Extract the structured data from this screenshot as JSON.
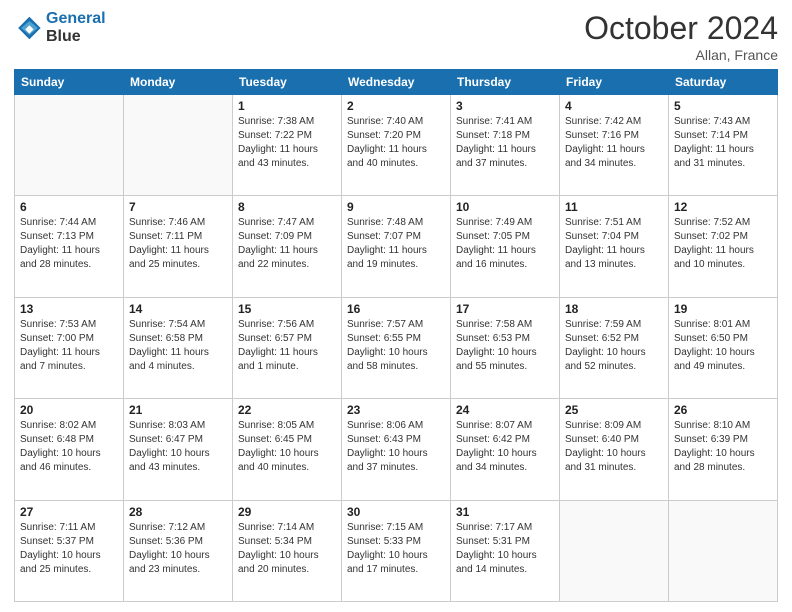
{
  "header": {
    "logo_line1": "General",
    "logo_line2": "Blue",
    "month_title": "October 2024",
    "location": "Allan, France"
  },
  "days_of_week": [
    "Sunday",
    "Monday",
    "Tuesday",
    "Wednesday",
    "Thursday",
    "Friday",
    "Saturday"
  ],
  "weeks": [
    [
      {
        "day": "",
        "info": ""
      },
      {
        "day": "",
        "info": ""
      },
      {
        "day": "1",
        "info": "Sunrise: 7:38 AM\nSunset: 7:22 PM\nDaylight: 11 hours and 43 minutes."
      },
      {
        "day": "2",
        "info": "Sunrise: 7:40 AM\nSunset: 7:20 PM\nDaylight: 11 hours and 40 minutes."
      },
      {
        "day": "3",
        "info": "Sunrise: 7:41 AM\nSunset: 7:18 PM\nDaylight: 11 hours and 37 minutes."
      },
      {
        "day": "4",
        "info": "Sunrise: 7:42 AM\nSunset: 7:16 PM\nDaylight: 11 hours and 34 minutes."
      },
      {
        "day": "5",
        "info": "Sunrise: 7:43 AM\nSunset: 7:14 PM\nDaylight: 11 hours and 31 minutes."
      }
    ],
    [
      {
        "day": "6",
        "info": "Sunrise: 7:44 AM\nSunset: 7:13 PM\nDaylight: 11 hours and 28 minutes."
      },
      {
        "day": "7",
        "info": "Sunrise: 7:46 AM\nSunset: 7:11 PM\nDaylight: 11 hours and 25 minutes."
      },
      {
        "day": "8",
        "info": "Sunrise: 7:47 AM\nSunset: 7:09 PM\nDaylight: 11 hours and 22 minutes."
      },
      {
        "day": "9",
        "info": "Sunrise: 7:48 AM\nSunset: 7:07 PM\nDaylight: 11 hours and 19 minutes."
      },
      {
        "day": "10",
        "info": "Sunrise: 7:49 AM\nSunset: 7:05 PM\nDaylight: 11 hours and 16 minutes."
      },
      {
        "day": "11",
        "info": "Sunrise: 7:51 AM\nSunset: 7:04 PM\nDaylight: 11 hours and 13 minutes."
      },
      {
        "day": "12",
        "info": "Sunrise: 7:52 AM\nSunset: 7:02 PM\nDaylight: 11 hours and 10 minutes."
      }
    ],
    [
      {
        "day": "13",
        "info": "Sunrise: 7:53 AM\nSunset: 7:00 PM\nDaylight: 11 hours and 7 minutes."
      },
      {
        "day": "14",
        "info": "Sunrise: 7:54 AM\nSunset: 6:58 PM\nDaylight: 11 hours and 4 minutes."
      },
      {
        "day": "15",
        "info": "Sunrise: 7:56 AM\nSunset: 6:57 PM\nDaylight: 11 hours and 1 minute."
      },
      {
        "day": "16",
        "info": "Sunrise: 7:57 AM\nSunset: 6:55 PM\nDaylight: 10 hours and 58 minutes."
      },
      {
        "day": "17",
        "info": "Sunrise: 7:58 AM\nSunset: 6:53 PM\nDaylight: 10 hours and 55 minutes."
      },
      {
        "day": "18",
        "info": "Sunrise: 7:59 AM\nSunset: 6:52 PM\nDaylight: 10 hours and 52 minutes."
      },
      {
        "day": "19",
        "info": "Sunrise: 8:01 AM\nSunset: 6:50 PM\nDaylight: 10 hours and 49 minutes."
      }
    ],
    [
      {
        "day": "20",
        "info": "Sunrise: 8:02 AM\nSunset: 6:48 PM\nDaylight: 10 hours and 46 minutes."
      },
      {
        "day": "21",
        "info": "Sunrise: 8:03 AM\nSunset: 6:47 PM\nDaylight: 10 hours and 43 minutes."
      },
      {
        "day": "22",
        "info": "Sunrise: 8:05 AM\nSunset: 6:45 PM\nDaylight: 10 hours and 40 minutes."
      },
      {
        "day": "23",
        "info": "Sunrise: 8:06 AM\nSunset: 6:43 PM\nDaylight: 10 hours and 37 minutes."
      },
      {
        "day": "24",
        "info": "Sunrise: 8:07 AM\nSunset: 6:42 PM\nDaylight: 10 hours and 34 minutes."
      },
      {
        "day": "25",
        "info": "Sunrise: 8:09 AM\nSunset: 6:40 PM\nDaylight: 10 hours and 31 minutes."
      },
      {
        "day": "26",
        "info": "Sunrise: 8:10 AM\nSunset: 6:39 PM\nDaylight: 10 hours and 28 minutes."
      }
    ],
    [
      {
        "day": "27",
        "info": "Sunrise: 7:11 AM\nSunset: 5:37 PM\nDaylight: 10 hours and 25 minutes."
      },
      {
        "day": "28",
        "info": "Sunrise: 7:12 AM\nSunset: 5:36 PM\nDaylight: 10 hours and 23 minutes."
      },
      {
        "day": "29",
        "info": "Sunrise: 7:14 AM\nSunset: 5:34 PM\nDaylight: 10 hours and 20 minutes."
      },
      {
        "day": "30",
        "info": "Sunrise: 7:15 AM\nSunset: 5:33 PM\nDaylight: 10 hours and 17 minutes."
      },
      {
        "day": "31",
        "info": "Sunrise: 7:17 AM\nSunset: 5:31 PM\nDaylight: 10 hours and 14 minutes."
      },
      {
        "day": "",
        "info": ""
      },
      {
        "day": "",
        "info": ""
      }
    ]
  ]
}
